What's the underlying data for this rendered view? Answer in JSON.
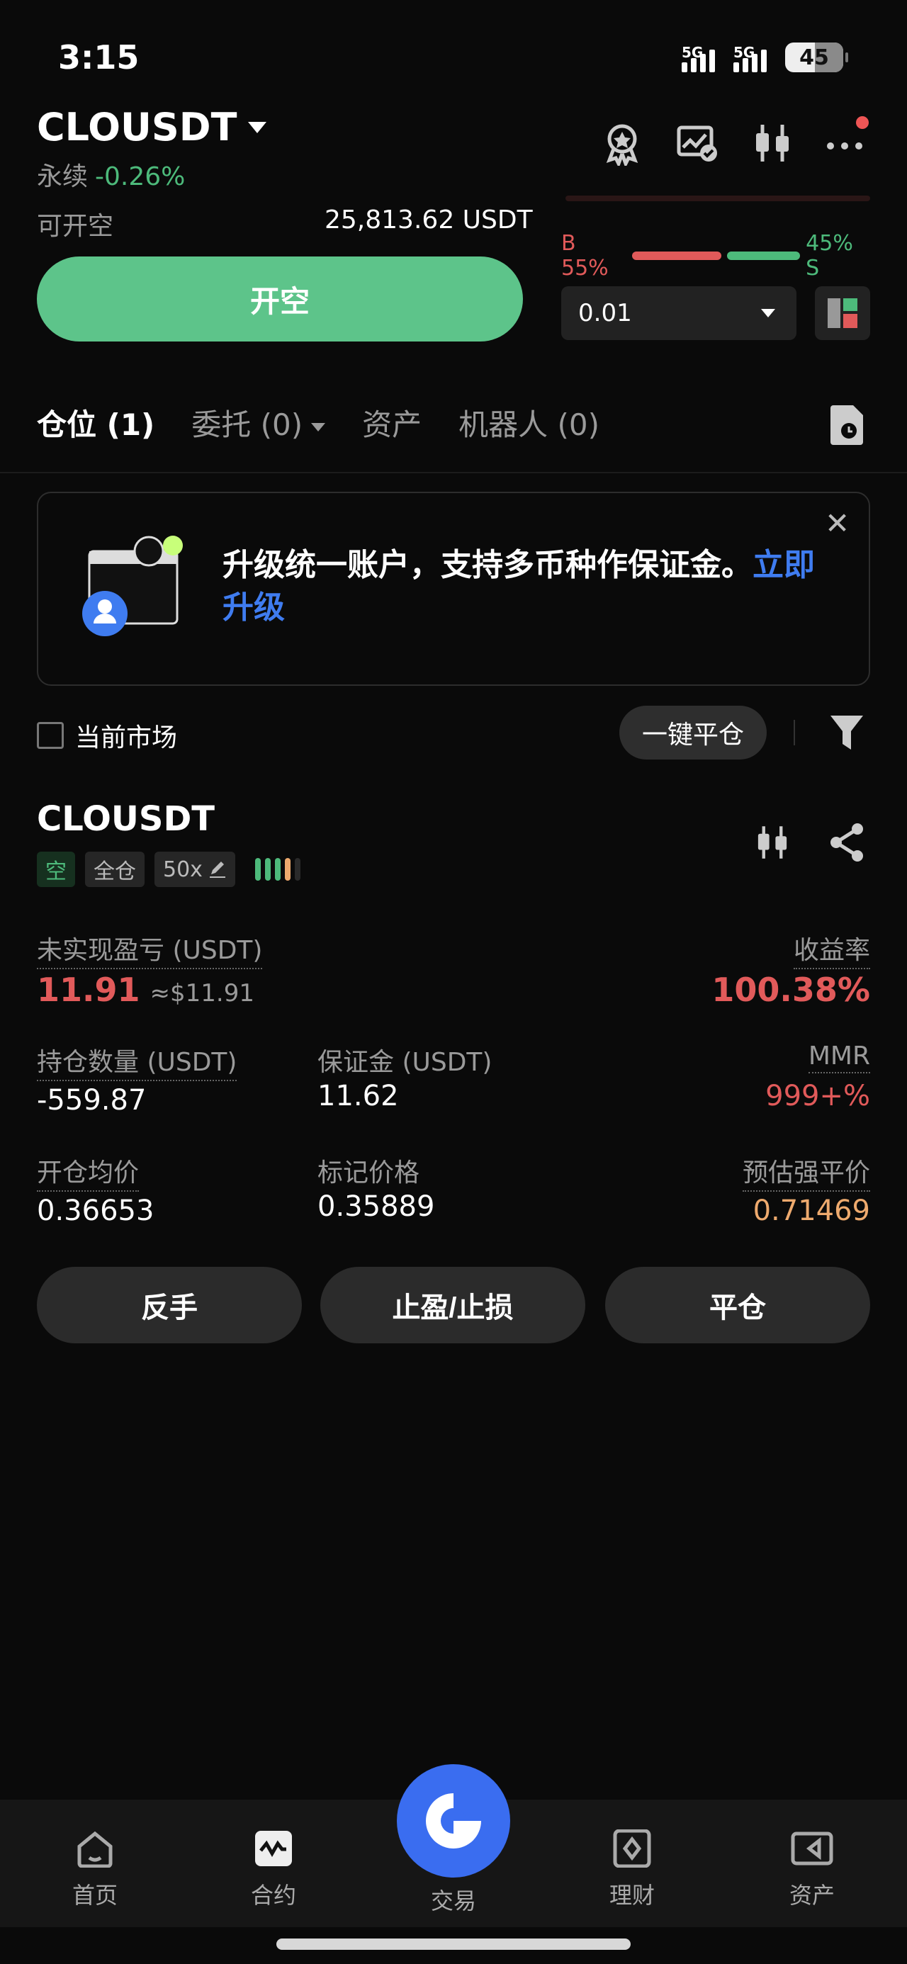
{
  "status": {
    "time": "3:15",
    "net1": "5G",
    "net2": "5G",
    "battery": "45"
  },
  "header": {
    "symbol": "CLOUSDT",
    "contract_type": "永续",
    "change": "-0.26%"
  },
  "order": {
    "available_label": "可开空",
    "available_value": "25,813.62 USDT",
    "open_button": "开空",
    "ratio_buy": "B 55%",
    "ratio_sell": "45% S",
    "ratio_buy_pct": 55,
    "quantity": "0.01"
  },
  "tabs": [
    {
      "label": "仓位 (1)"
    },
    {
      "label": "委托 (0)"
    },
    {
      "label": "资产"
    },
    {
      "label": "机器人 (0)"
    }
  ],
  "banner": {
    "text": "升级统一账户，支持多币种作保证金。",
    "link": "立即升级"
  },
  "filters": {
    "current_market": "当前市场",
    "close_all": "一键平仓"
  },
  "position": {
    "symbol": "CLOUSDT",
    "side": "空",
    "margin_mode": "全仓",
    "leverage": "50x",
    "unrealized_pnl_label": "未实现盈亏 (USDT)",
    "unrealized_pnl": "11.91",
    "unrealized_pnl_usd": "≈$11.91",
    "roe_label": "收益率",
    "roe": "100.38%",
    "size_label": "持仓数量 (USDT)",
    "size": "-559.87",
    "margin_label": "保证金 (USDT)",
    "margin": "11.62",
    "mmr_label": "MMR",
    "mmr": "999+%",
    "entry_label": "开仓均价",
    "entry": "0.36653",
    "mark_label": "标记价格",
    "mark": "0.35889",
    "liq_label": "预估强平价",
    "liq": "0.71469"
  },
  "actions": {
    "reverse": "反手",
    "tpsl": "止盈/止损",
    "close": "平仓"
  },
  "nav": [
    {
      "label": "首页",
      "icon": "home-icon"
    },
    {
      "label": "合约",
      "icon": "futures-icon"
    },
    {
      "label": "交易",
      "icon": "trade-icon"
    },
    {
      "label": "理财",
      "icon": "earn-icon"
    },
    {
      "label": "资产",
      "icon": "wallet-icon"
    }
  ],
  "colors": {
    "green": "#5dc48a",
    "red": "#e15a5a",
    "accent": "#3a6df0",
    "orange": "#eeaa6e"
  }
}
